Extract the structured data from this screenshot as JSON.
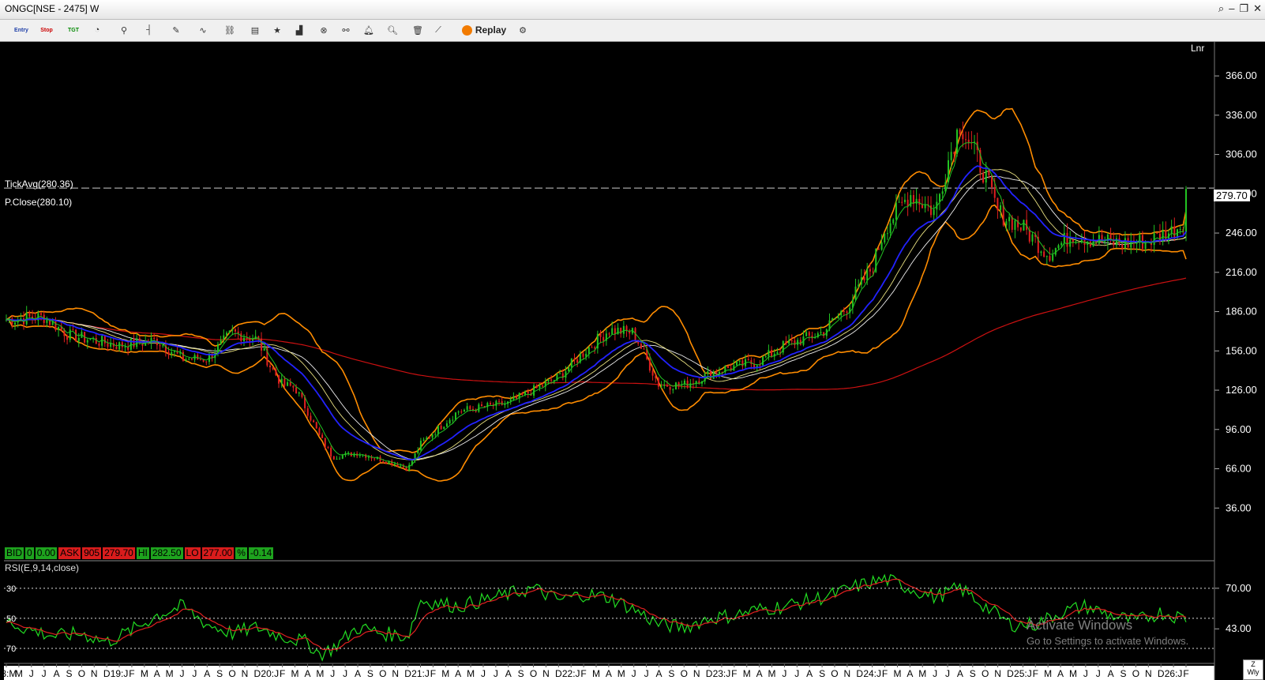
{
  "window": {
    "title": "ONGC[NSE - 2475] W"
  },
  "toolbar": {
    "entry": "Entry",
    "stop": "Stop",
    "tgt": "TGT",
    "replay": "Replay"
  },
  "chart_labels": {
    "scale_mode": "Lnr",
    "tick_avg": "TickAvg(280.36)",
    "prev_close": "P.Close(280.10)",
    "last_price": "279.70",
    "rsi_title": "RSI(E,9,14,close)"
  },
  "quote": {
    "bid_label": "BID",
    "bid_qty": "0",
    "bid": "0.00",
    "ask_label": "ASK",
    "ask_qty": "905",
    "ask": "279.70",
    "hi_label": "HI",
    "hi": "282.50",
    "lo_label": "LO",
    "lo": "277.00",
    "pct_label": "%",
    "pct": "-0.14"
  },
  "watermark": {
    "line1": "Activate Windows",
    "line2": "Go to Settings to activate Windows."
  },
  "corner": {
    "z": "Z",
    "wly": "Wly"
  },
  "colors": {
    "up": "#22c322",
    "down": "#e02020",
    "bb": "#ff8c00",
    "ema_blue": "#2222ff",
    "sma200": "#cc1111",
    "rsi": "#22dd22",
    "rsi_signal": "#e02020"
  },
  "chart_data": [
    {
      "type": "candlestick",
      "symbol": "ONGC",
      "timeframe": "W",
      "y_scale": "linear",
      "ylim": [
        6,
        392
      ],
      "yticks": [
        36,
        66,
        96,
        126,
        156,
        186,
        216,
        246,
        276,
        306,
        336,
        366
      ],
      "ytick_labels": [
        "36.00",
        "66.00",
        "96.00",
        "126.00",
        "156.00",
        "186.00",
        "216.00",
        "246.00",
        "276.00",
        "306.00",
        "336.00",
        "366.00"
      ],
      "xtick_labels": [
        "18:M",
        "M",
        "J",
        "J",
        "A",
        "S",
        "O",
        "N",
        "D",
        "19:J",
        "F",
        "M",
        "A",
        "M",
        "J",
        "J",
        "A",
        "S",
        "O",
        "N",
        "D",
        "20:J",
        "F",
        "M",
        "A",
        "M",
        "J",
        "J",
        "A",
        "S",
        "O",
        "N",
        "D",
        "21:J",
        "F",
        "M",
        "A",
        "M",
        "J",
        "J",
        "A",
        "S",
        "O",
        "N",
        "D",
        "22:J",
        "F",
        "M",
        "A",
        "M",
        "J",
        "J",
        "A",
        "S",
        "O",
        "N",
        "D",
        "23:J",
        "F",
        "M",
        "A",
        "M",
        "J",
        "J",
        "A",
        "S",
        "O",
        "N",
        "D",
        "24:J",
        "F",
        "M",
        "A",
        "M",
        "J",
        "J",
        "A",
        "S",
        "O",
        "N",
        "D",
        "25:J",
        "F",
        "M",
        "A",
        "M",
        "J",
        "J",
        "A",
        "S",
        "O",
        "N",
        "D",
        "26:J",
        "F"
      ],
      "x_start": "2018-03",
      "x_end": "2026-02",
      "close_anchors": [
        [
          0,
          180
        ],
        [
          3,
          182
        ],
        [
          5,
          168
        ],
        [
          9,
          160
        ],
        [
          12,
          164
        ],
        [
          14,
          150
        ],
        [
          16,
          150
        ],
        [
          18,
          170
        ],
        [
          20,
          165
        ],
        [
          21,
          145
        ],
        [
          22,
          130
        ],
        [
          23,
          128
        ],
        [
          24,
          110
        ],
        [
          25,
          90
        ],
        [
          26,
          75
        ],
        [
          28,
          78
        ],
        [
          31,
          70
        ],
        [
          32,
          66
        ],
        [
          33,
          85
        ],
        [
          36,
          110
        ],
        [
          40,
          116
        ],
        [
          44,
          136
        ],
        [
          46,
          155
        ],
        [
          48,
          172
        ],
        [
          50,
          170
        ],
        [
          51,
          150
        ],
        [
          52,
          130
        ],
        [
          54,
          130
        ],
        [
          57,
          142
        ],
        [
          60,
          148
        ],
        [
          62,
          160
        ],
        [
          65,
          170
        ],
        [
          67,
          190
        ],
        [
          69,
          220
        ],
        [
          70,
          250
        ],
        [
          72,
          276
        ],
        [
          74,
          262
        ],
        [
          75,
          300
        ],
        [
          76,
          330
        ],
        [
          78,
          290
        ],
        [
          79,
          262
        ],
        [
          81,
          250
        ],
        [
          83,
          230
        ],
        [
          85,
          245
        ],
        [
          87,
          240
        ],
        [
          89,
          238
        ],
        [
          91,
          240
        ],
        [
          93,
          248
        ],
        [
          94,
          256
        ],
        [
          95,
          276
        ]
      ],
      "last": 279.7,
      "tick_avg": 280.36,
      "prev_close": 280.1,
      "indicators": [
        "Bollinger Bands",
        "EMA (blue)",
        "moving averages (yellow, white)",
        "SMA long (red)",
        "EMA short (green)"
      ]
    },
    {
      "type": "line",
      "name": "RSI(E,9,14,close)",
      "ylim": [
        20,
        82
      ],
      "levels": [
        30,
        50,
        70
      ],
      "left_labels": [
        "70",
        "50",
        "30"
      ],
      "right_labels": [
        "70.00",
        "43.00"
      ],
      "rsi_anchors": [
        [
          0,
          48
        ],
        [
          2,
          42
        ],
        [
          4,
          38
        ],
        [
          6,
          40
        ],
        [
          8,
          34
        ],
        [
          10,
          42
        ],
        [
          12,
          52
        ],
        [
          14,
          58
        ],
        [
          16,
          46
        ],
        [
          18,
          40
        ],
        [
          20,
          44
        ],
        [
          22,
          38
        ],
        [
          24,
          34
        ],
        [
          25,
          26
        ],
        [
          26,
          30
        ],
        [
          28,
          44
        ],
        [
          30,
          40
        ],
        [
          32,
          38
        ],
        [
          33,
          62
        ],
        [
          36,
          58
        ],
        [
          40,
          66
        ],
        [
          42,
          70
        ],
        [
          44,
          62
        ],
        [
          46,
          66
        ],
        [
          48,
          64
        ],
        [
          50,
          56
        ],
        [
          52,
          46
        ],
        [
          54,
          44
        ],
        [
          56,
          50
        ],
        [
          58,
          52
        ],
        [
          60,
          56
        ],
        [
          62,
          58
        ],
        [
          64,
          62
        ],
        [
          66,
          66
        ],
        [
          68,
          72
        ],
        [
          70,
          76
        ],
        [
          72,
          70
        ],
        [
          74,
          64
        ],
        [
          76,
          70
        ],
        [
          78,
          58
        ],
        [
          80,
          46
        ],
        [
          82,
          46
        ],
        [
          84,
          54
        ],
        [
          86,
          58
        ],
        [
          88,
          52
        ],
        [
          90,
          48
        ],
        [
          92,
          54
        ],
        [
          94,
          50
        ],
        [
          95,
          62
        ]
      ]
    }
  ]
}
